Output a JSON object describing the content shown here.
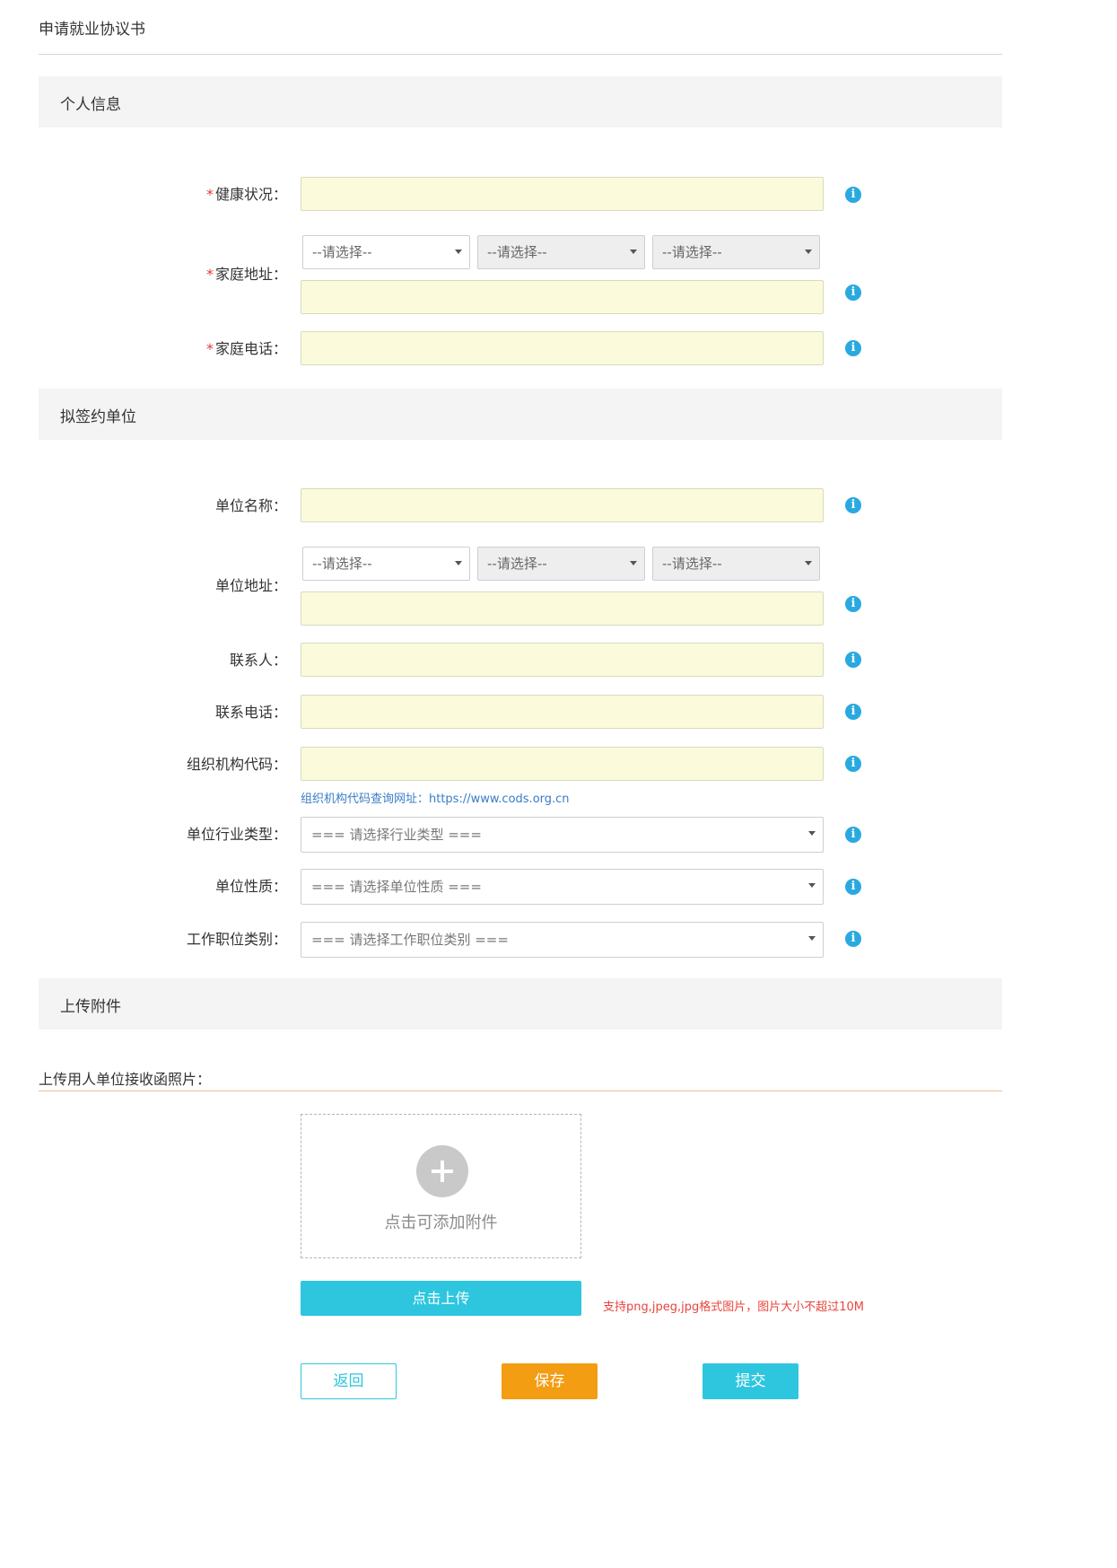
{
  "page": {
    "title": "申请就业协议书"
  },
  "sections": {
    "personal": "个人信息",
    "employer": "拟签约单位",
    "attachments": "上传附件"
  },
  "personal": {
    "health": {
      "label": "健康状况：",
      "required": true
    },
    "home_address": {
      "label": "家庭地址：",
      "required": true
    },
    "home_phone": {
      "label": "家庭电话：",
      "required": true
    }
  },
  "employer": {
    "name": {
      "label": "单位名称："
    },
    "address": {
      "label": "单位地址："
    },
    "contact": {
      "label": "联系人："
    },
    "contact_phone": {
      "label": "联系电话："
    },
    "org_code": {
      "label": "组织机构代码：",
      "hint": "组织机构代码查询网址：https://www.cods.org.cn"
    },
    "industry": {
      "label": "单位行业类型：",
      "placeholder": "=== 请选择行业类型 ==="
    },
    "nature": {
      "label": "单位性质：",
      "placeholder": "=== 请选择单位性质 ==="
    },
    "job_category": {
      "label": "工作职位类别：",
      "placeholder": "=== 请选择工作职位类别 ==="
    }
  },
  "region_select": {
    "placeholder": "--请选择--"
  },
  "required_mark": "*",
  "info_icon_glyph": "i",
  "upload": {
    "heading": "上传用人单位接收函照片：",
    "dropzone_text": "点击可添加附件",
    "button": "点击上传",
    "note": "支持png,jpeg,jpg格式图片，图片大小不超过10M"
  },
  "actions": {
    "back": "返回",
    "save": "保存",
    "submit": "提交"
  },
  "colors": {
    "input_bg": "#fbfbdc",
    "info_icon": "#29a9e0",
    "required": "#e4393c",
    "primary": "#2ec6df",
    "save": "#f29d12",
    "link": "#3a7cc7",
    "note": "#e8453c"
  }
}
